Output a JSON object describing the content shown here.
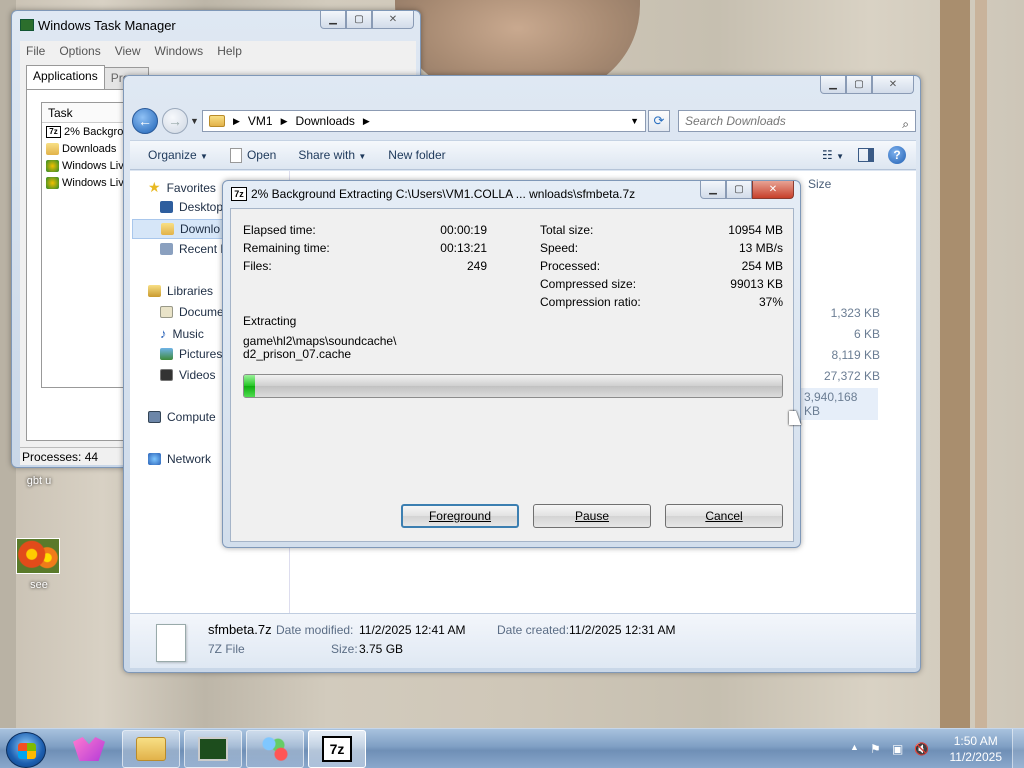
{
  "desktop": {
    "icons": [
      {
        "label": "gbt u"
      },
      {
        "label": "see"
      }
    ]
  },
  "task_manager": {
    "title": "Windows Task Manager",
    "menu": [
      "File",
      "Options",
      "View",
      "Windows",
      "Help"
    ],
    "tabs": [
      "Applications",
      "Proce"
    ],
    "column_task": "Task",
    "tasks": [
      "2% Backgro",
      "Downloads",
      "Windows Liv",
      "Windows Liv"
    ],
    "status": "Processes: 44"
  },
  "explorer": {
    "breadcrumb": [
      "VM1",
      "Downloads"
    ],
    "search_placeholder": "Search Downloads",
    "toolbar": {
      "organize": "Organize",
      "open": "Open",
      "share_with": "Share with",
      "new_folder": "New folder"
    },
    "nav": {
      "favorites": "Favorites",
      "desktop": "Desktop",
      "downloads": "Downlo",
      "recent": "Recent P",
      "libraries": "Libraries",
      "documents": "Docume",
      "music": "Music",
      "pictures": "Pictures",
      "videos": "Videos",
      "computer": "Compute",
      "network": "Network"
    },
    "size_header": "Size",
    "sizes": [
      "1,323 KB",
      "6 KB",
      "8,119 KB",
      "27,372 KB",
      "3,940,168 KB"
    ],
    "details": {
      "file_name": "sfmbeta.7z",
      "file_type": "7Z File",
      "modified_label": "Date modified:",
      "modified_value": "11/2/2025 12:41 AM",
      "created_label": "Date created:",
      "created_value": "11/2/2025 12:31 AM",
      "size_label": "Size:",
      "size_value": "3.75 GB"
    }
  },
  "dialog": {
    "title": "2% Background Extracting C:\\Users\\VM1.COLLA ... wnloads\\sfmbeta.7z",
    "elapsed_label": "Elapsed time:",
    "elapsed_value": "00:00:19",
    "remaining_label": "Remaining time:",
    "remaining_value": "00:13:21",
    "files_label": "Files:",
    "files_value": "249",
    "total_size_label": "Total size:",
    "total_size_value": "10954 MB",
    "speed_label": "Speed:",
    "speed_value": "13 MB/s",
    "processed_label": "Processed:",
    "processed_value": "254 MB",
    "compressed_label": "Compressed size:",
    "compressed_value": "99013 KB",
    "ratio_label": "Compression ratio:",
    "ratio_value": "37%",
    "extracting_label": "Extracting",
    "current_path_1": "game\\hl2\\maps\\soundcache\\",
    "current_path_2": "d2_prison_07.cache",
    "progress_percent": 2,
    "buttons": {
      "foreground": "Foreground",
      "pause": "Pause",
      "cancel": "Cancel"
    }
  },
  "taskbar": {
    "time": "1:50 AM",
    "date": "11/2/2025",
    "sevenzip_label": "7z"
  }
}
